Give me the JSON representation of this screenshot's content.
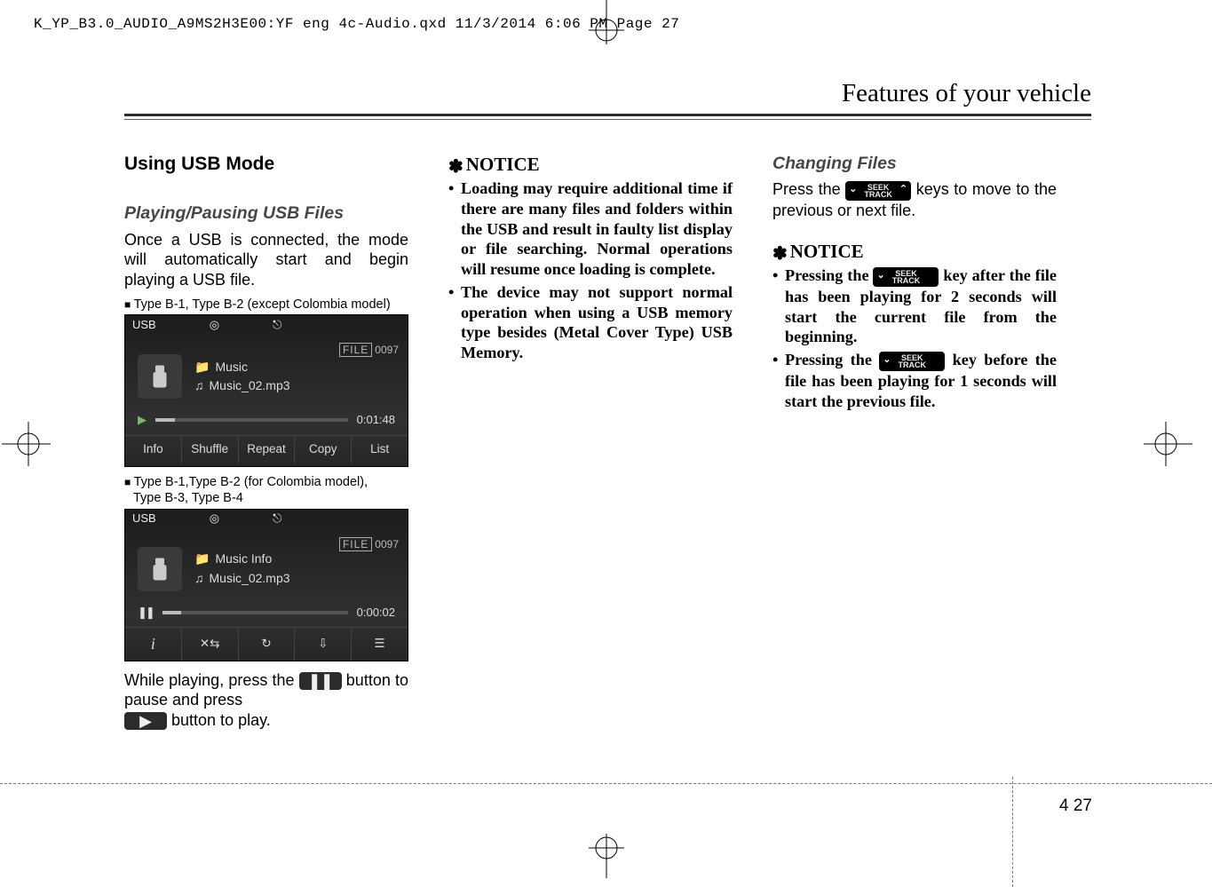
{
  "print_header": "K_YP_B3.0_AUDIO_A9MS2H3E00:YF eng 4c-Audio.qxd  11/3/2014  6:06 PM  Page 27",
  "page_title": "Features of your vehicle",
  "page_number_section": "4",
  "page_number": "27",
  "col1": {
    "heading": "Using USB Mode",
    "sub1": "Playing/Pausing USB Files",
    "para1": "Once a USB is connected, the mode will automatically start and begin playing a USB file.",
    "cap1": "Type B-1, Type B-2 (except Colombia model)",
    "cap2_line1": "Type B-1,Type B-2 (for Colombia model),",
    "cap2_line2": "Type B-3, Type B-4",
    "after_prefix": "While playing, press the ",
    "after_mid": " button to pause and press ",
    "after_suffix": " button to play."
  },
  "screenshot1": {
    "title": "USB",
    "file_tag_label": "FILE",
    "file_tag_num": "0097",
    "folder": "Music",
    "track": "Music_02.mp3",
    "time": "0:01:48",
    "b1": "Info",
    "b2": "Shuffle",
    "b3": "Repeat",
    "b4": "Copy",
    "b5": "List"
  },
  "screenshot2": {
    "title": "USB",
    "file_tag_label": "FILE",
    "file_tag_num": "0097",
    "folder": "Music Info",
    "track": "Music_02.mp3",
    "time": "0:00:02"
  },
  "col2": {
    "notice": "NOTICE",
    "li1": "Loading may require additional time if there are many files and folders within the USB and result in faulty list display or file searching. Normal operations will resume once loading is complete.",
    "li2": "The device may not support normal operation when using a USB memory type besides (Metal Cover Type) USB Memory."
  },
  "col3": {
    "sub": "Changing Files",
    "para_prefix": "Press the ",
    "para_suffix": " keys to move to the previous or next file.",
    "notice": "NOTICE",
    "li1_prefix": "Pressing the ",
    "li1_suffix": " key after the file has been playing for 2 seconds will start the current file from the beginning.",
    "li2_prefix": "Pressing the ",
    "li2_suffix": " key before the file has been playing for 1 seconds will start the previous file.",
    "seek_top": "SEEK",
    "seek_bot": "TRACK"
  }
}
